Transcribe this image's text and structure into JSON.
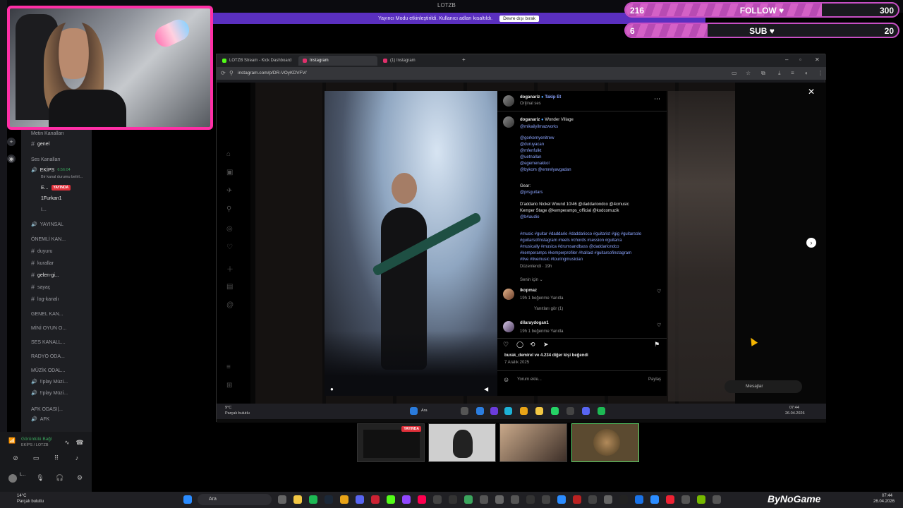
{
  "top": {
    "title": "LOTZB",
    "banner_text": "Yayıncı Modu etkinleştirildi. Kullanıcı adları kısaltıldı.",
    "banner_button": "Devre dışı bırak"
  },
  "goals": {
    "follow": {
      "current": "216",
      "label": "FOLLOW ♥",
      "target": "300",
      "progress": 0.72
    },
    "sub": {
      "current": "6",
      "label": "SUB ♥",
      "target": "20",
      "progress": 0.3
    }
  },
  "discord": {
    "category_text": "Metin Kanalları",
    "genel": "genel",
    "voice_category": "Ses Kanalları",
    "ekips": "EKİPS",
    "ekips_timer": "6:56:04",
    "ekips_status": "Bir kanal durumu belirl...",
    "member1": "E...",
    "member1_badge": "YAYINDA",
    "member2": "1Furkan1",
    "member3": "I...",
    "yayinsal": "YAYINSAL",
    "important": "ÖNEMLİ KAN...",
    "duyuru": "duyuru",
    "kurallar": "kurallar",
    "gelen": "gelen-gi...",
    "sayac": "sayaç",
    "log": "log-kanalı",
    "genel_kan": "GENEL KAN...",
    "mini": "MİNİ OYUN O...",
    "ses": "SES KANALL...",
    "radyo": "RADYO ODA...",
    "muzik": "MÜZİK ODAL...",
    "play1": "!!play Müzi...",
    "play2": "!!play Müzi...",
    "afk_cat": "AFK ODASI|...",
    "afk": "AFK",
    "voice_title": "Görüntülü Bağl",
    "voice_sub": "EKİPS / LOTZB",
    "user": "L..."
  },
  "browser": {
    "tabs": [
      {
        "label": "LOTZB Stream - Kick Dashboard",
        "color": "#53fc18"
      },
      {
        "label": "Instagram",
        "color": "#e1306c"
      },
      {
        "label": "(1) Instagram",
        "color": "#e1306c"
      }
    ],
    "url": "instagram.com/p/DR-VOyKDVFV/"
  },
  "post": {
    "author": "doganariz",
    "follow": "Takip Et",
    "sound": "Orijinal ses",
    "caption_author": "doganariz",
    "location": "Wonder Village",
    "handle1": "@mikailyilmazworks",
    "handle2": "@gorkemyenitrew",
    "handle3": "@duruyacan",
    "handle4": "@mfenfulkt",
    "handle5": "@uetnallan",
    "handle6": "@egemenakkol",
    "handle7": "@bykom @emrelyavgadan",
    "gear_label": "Gear:",
    "gear1": "@prsguitars",
    "gear2": "D'addario Nickel Wound 10/46 @daddariondco @4cmusic",
    "gear3": "Kemper Stage @kemperamps_official @kodcomuzik",
    "gear4": "@b4audio",
    "tags1": "#music #guitar #daddario #daddarioco #guitarist #gig #guitarsolo",
    "tags2": "#guitarsofinstagram #reels #chords #session #guitarra",
    "tags3": "#musically #musica #drumsandbass @daddariondco",
    "tags4": "#kemperamps #kemperprofiler #hallaid #guitarsofinstagram",
    "tags5": "#live #livemusic #touringmusician",
    "edited": "Düzenlendi · 19h",
    "for_you": "Senin için ⌄",
    "c1_user": "ikopmaz",
    "c1_meta": "19h   1 beğenme   Yanıtla",
    "c1_replies": "Yanıtları gör (1)",
    "c2_user": "dilaraydogan1",
    "c2_meta": "19h   1 beğenme   Yanıtla",
    "likes": "burak_demirel ve 4.234 diğer kişi beğendi",
    "date": "7 Aralık 2025",
    "comment_placeholder": "Yorum ekle...",
    "share": "Paylaş",
    "messages": "Mesajlar"
  },
  "inner_taskbar": {
    "weather": "9°C",
    "weather_sub": "Parçalı bulutlu",
    "search": "Ara",
    "time": "07:44",
    "date": "26.04.2026"
  },
  "thumbs": {
    "badge": "YAYINDA"
  },
  "taskbar": {
    "weather": "14°C",
    "weather_sub": "Parçalı bulutlu",
    "search": "Ara",
    "brand": "ByNoGame",
    "time": "07:44",
    "date": "26.04.2026"
  }
}
